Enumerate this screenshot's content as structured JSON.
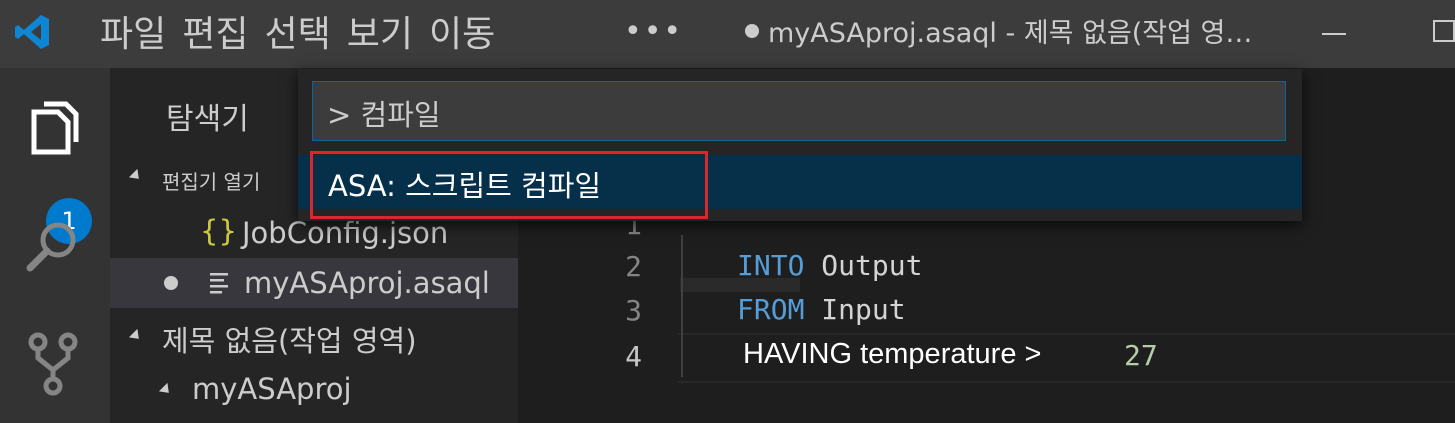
{
  "titlebar": {
    "menu": [
      "파일",
      "편집",
      "선택",
      "보기",
      "이동"
    ],
    "more": "•••",
    "window_title": "myASAproj.asaql - 제목 없음(작업 영…"
  },
  "activity": {
    "badge": "1"
  },
  "sidebar": {
    "title": "탐색기",
    "open_editors": "편집기 열기",
    "file1": "JobConfig.json",
    "file1_icon": "{}",
    "file2": "myASAproj.asaql",
    "workspace": "제목 없음(작업 영역)",
    "folder": "myASAproj"
  },
  "quickopen": {
    "input": "> 컴파일",
    "selected": "ASA: 스크립트 컴파일"
  },
  "editor": {
    "line_numbers": [
      "1",
      "2",
      "3",
      "4"
    ],
    "line2": {
      "kw": "INTO",
      "id": "Output"
    },
    "line3": {
      "kw": "FROM",
      "id": "Input"
    },
    "line4": {
      "text": "HAVING temperature >",
      "num": "27"
    }
  },
  "colors": {
    "accent": "#007acc",
    "highlight_border": "#d9262f",
    "keyword": "#569cd6"
  }
}
